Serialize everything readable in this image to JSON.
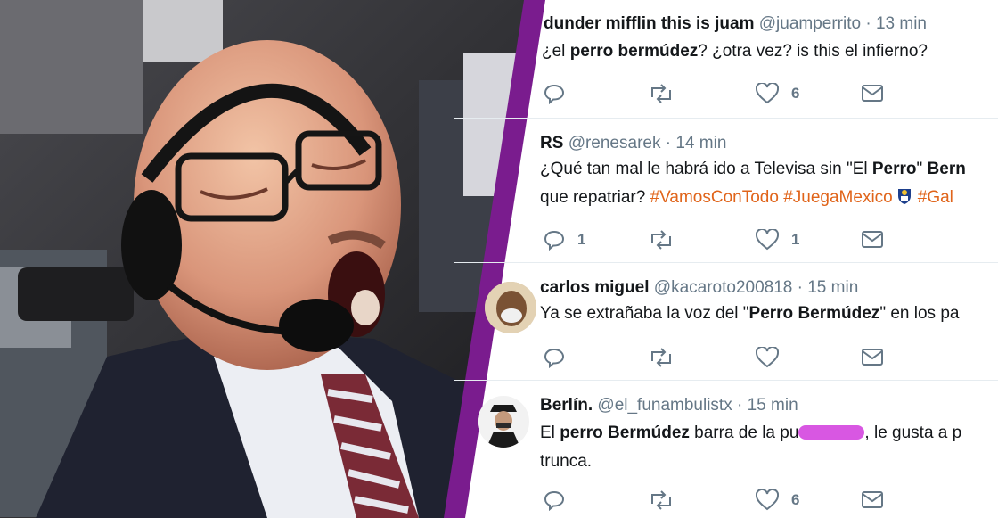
{
  "colors": {
    "divider": "#7a1c8e",
    "hashtag": "#e0641a",
    "meta": "#657786",
    "text": "#14171a",
    "censor": "#d64ee0"
  },
  "photo": {
    "subject": "commentator-with-headset"
  },
  "tweets": [
    {
      "name": "dunder mifflin this is juam",
      "handle": "@juamperrito",
      "time": "13 min",
      "text_parts": {
        "p1": "¿el ",
        "b1": "perro bermúdez",
        "p2": "? ¿otra vez? is this el infierno?"
      },
      "reply_count": "",
      "retweet_count": "",
      "like_count": "6"
    },
    {
      "name": "RS",
      "handle": "@renesarek",
      "time": "14 min",
      "text_parts": {
        "p1": "¿Qué tan mal le habrá ido a Televisa sin \"El ",
        "b1": "Perro",
        "p2": "\" ",
        "b2": "Bern",
        "line2": "que repatriar? ",
        "h1": "#VamosConTodo",
        "h2": "#JuegaMexico",
        "h3": "#Gal"
      },
      "reply_count": "1",
      "retweet_count": "",
      "like_count": "1"
    },
    {
      "name": "carlos miguel",
      "handle": "@kacaroto200818",
      "time": "15 min",
      "text_parts": {
        "p1": "Ya se extrañaba la voz del \"",
        "b1": "Perro Bermúdez",
        "p2": "\" en los pa"
      },
      "reply_count": "",
      "retweet_count": "",
      "like_count": ""
    },
    {
      "name": "Berlín.",
      "handle": "@el_funambulistx",
      "time": "15 min",
      "text_parts": {
        "p1": "El ",
        "b1": "perro Bermúdez",
        "p2": " barra de la pu",
        "p3": ", le gusta a p",
        "line2": "trunca."
      },
      "reply_count": "",
      "retweet_count": "",
      "like_count": "6"
    }
  ],
  "icons": {
    "reply": "reply-icon",
    "retweet": "retweet-icon",
    "like": "like-icon",
    "dm": "message-icon"
  }
}
